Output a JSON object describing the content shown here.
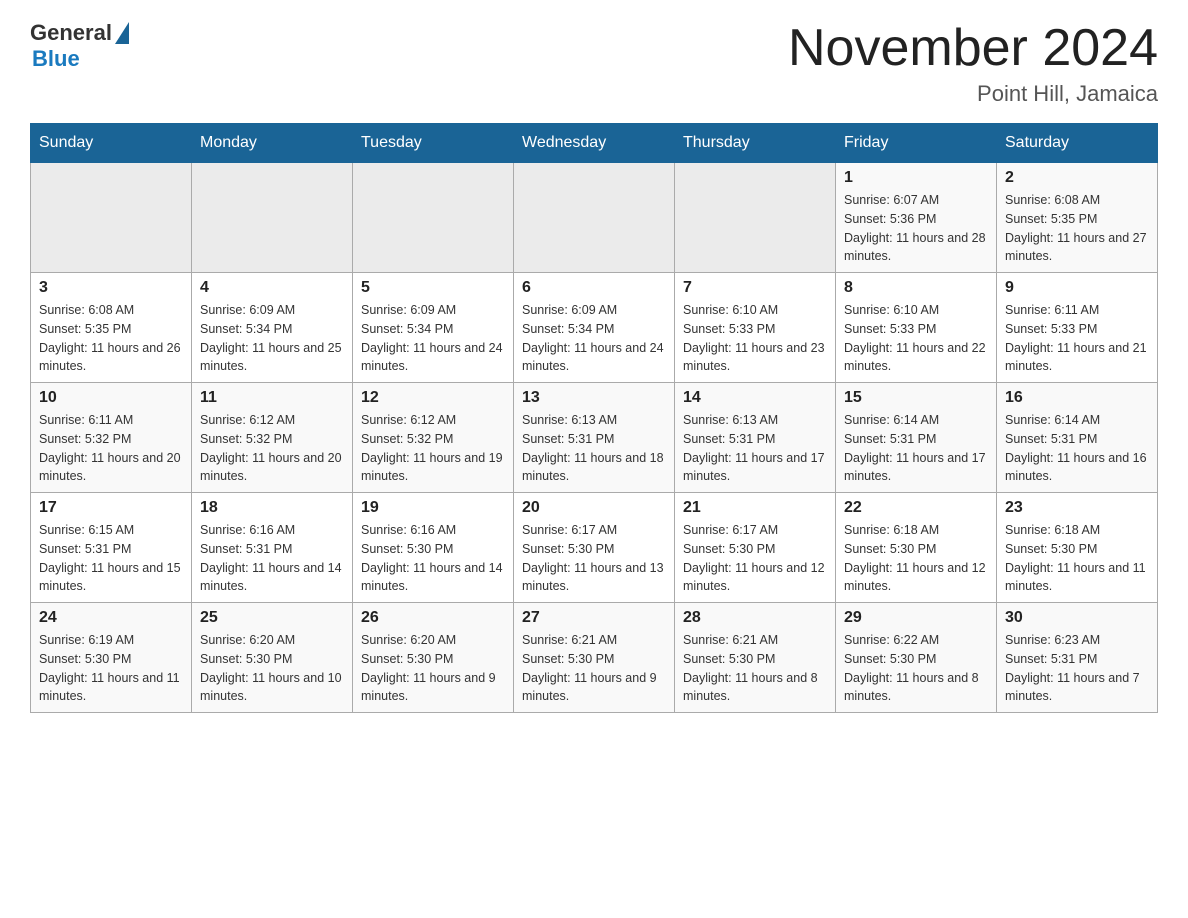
{
  "header": {
    "logo_general": "General",
    "logo_blue": "Blue",
    "title": "November 2024",
    "subtitle": "Point Hill, Jamaica"
  },
  "days_of_week": [
    "Sunday",
    "Monday",
    "Tuesday",
    "Wednesday",
    "Thursday",
    "Friday",
    "Saturday"
  ],
  "weeks": [
    [
      {
        "day": "",
        "info": ""
      },
      {
        "day": "",
        "info": ""
      },
      {
        "day": "",
        "info": ""
      },
      {
        "day": "",
        "info": ""
      },
      {
        "day": "",
        "info": ""
      },
      {
        "day": "1",
        "info": "Sunrise: 6:07 AM\nSunset: 5:36 PM\nDaylight: 11 hours and 28 minutes."
      },
      {
        "day": "2",
        "info": "Sunrise: 6:08 AM\nSunset: 5:35 PM\nDaylight: 11 hours and 27 minutes."
      }
    ],
    [
      {
        "day": "3",
        "info": "Sunrise: 6:08 AM\nSunset: 5:35 PM\nDaylight: 11 hours and 26 minutes."
      },
      {
        "day": "4",
        "info": "Sunrise: 6:09 AM\nSunset: 5:34 PM\nDaylight: 11 hours and 25 minutes."
      },
      {
        "day": "5",
        "info": "Sunrise: 6:09 AM\nSunset: 5:34 PM\nDaylight: 11 hours and 24 minutes."
      },
      {
        "day": "6",
        "info": "Sunrise: 6:09 AM\nSunset: 5:34 PM\nDaylight: 11 hours and 24 minutes."
      },
      {
        "day": "7",
        "info": "Sunrise: 6:10 AM\nSunset: 5:33 PM\nDaylight: 11 hours and 23 minutes."
      },
      {
        "day": "8",
        "info": "Sunrise: 6:10 AM\nSunset: 5:33 PM\nDaylight: 11 hours and 22 minutes."
      },
      {
        "day": "9",
        "info": "Sunrise: 6:11 AM\nSunset: 5:33 PM\nDaylight: 11 hours and 21 minutes."
      }
    ],
    [
      {
        "day": "10",
        "info": "Sunrise: 6:11 AM\nSunset: 5:32 PM\nDaylight: 11 hours and 20 minutes."
      },
      {
        "day": "11",
        "info": "Sunrise: 6:12 AM\nSunset: 5:32 PM\nDaylight: 11 hours and 20 minutes."
      },
      {
        "day": "12",
        "info": "Sunrise: 6:12 AM\nSunset: 5:32 PM\nDaylight: 11 hours and 19 minutes."
      },
      {
        "day": "13",
        "info": "Sunrise: 6:13 AM\nSunset: 5:31 PM\nDaylight: 11 hours and 18 minutes."
      },
      {
        "day": "14",
        "info": "Sunrise: 6:13 AM\nSunset: 5:31 PM\nDaylight: 11 hours and 17 minutes."
      },
      {
        "day": "15",
        "info": "Sunrise: 6:14 AM\nSunset: 5:31 PM\nDaylight: 11 hours and 17 minutes."
      },
      {
        "day": "16",
        "info": "Sunrise: 6:14 AM\nSunset: 5:31 PM\nDaylight: 11 hours and 16 minutes."
      }
    ],
    [
      {
        "day": "17",
        "info": "Sunrise: 6:15 AM\nSunset: 5:31 PM\nDaylight: 11 hours and 15 minutes."
      },
      {
        "day": "18",
        "info": "Sunrise: 6:16 AM\nSunset: 5:31 PM\nDaylight: 11 hours and 14 minutes."
      },
      {
        "day": "19",
        "info": "Sunrise: 6:16 AM\nSunset: 5:30 PM\nDaylight: 11 hours and 14 minutes."
      },
      {
        "day": "20",
        "info": "Sunrise: 6:17 AM\nSunset: 5:30 PM\nDaylight: 11 hours and 13 minutes."
      },
      {
        "day": "21",
        "info": "Sunrise: 6:17 AM\nSunset: 5:30 PM\nDaylight: 11 hours and 12 minutes."
      },
      {
        "day": "22",
        "info": "Sunrise: 6:18 AM\nSunset: 5:30 PM\nDaylight: 11 hours and 12 minutes."
      },
      {
        "day": "23",
        "info": "Sunrise: 6:18 AM\nSunset: 5:30 PM\nDaylight: 11 hours and 11 minutes."
      }
    ],
    [
      {
        "day": "24",
        "info": "Sunrise: 6:19 AM\nSunset: 5:30 PM\nDaylight: 11 hours and 11 minutes."
      },
      {
        "day": "25",
        "info": "Sunrise: 6:20 AM\nSunset: 5:30 PM\nDaylight: 11 hours and 10 minutes."
      },
      {
        "day": "26",
        "info": "Sunrise: 6:20 AM\nSunset: 5:30 PM\nDaylight: 11 hours and 9 minutes."
      },
      {
        "day": "27",
        "info": "Sunrise: 6:21 AM\nSunset: 5:30 PM\nDaylight: 11 hours and 9 minutes."
      },
      {
        "day": "28",
        "info": "Sunrise: 6:21 AM\nSunset: 5:30 PM\nDaylight: 11 hours and 8 minutes."
      },
      {
        "day": "29",
        "info": "Sunrise: 6:22 AM\nSunset: 5:30 PM\nDaylight: 11 hours and 8 minutes."
      },
      {
        "day": "30",
        "info": "Sunrise: 6:23 AM\nSunset: 5:31 PM\nDaylight: 11 hours and 7 minutes."
      }
    ]
  ]
}
